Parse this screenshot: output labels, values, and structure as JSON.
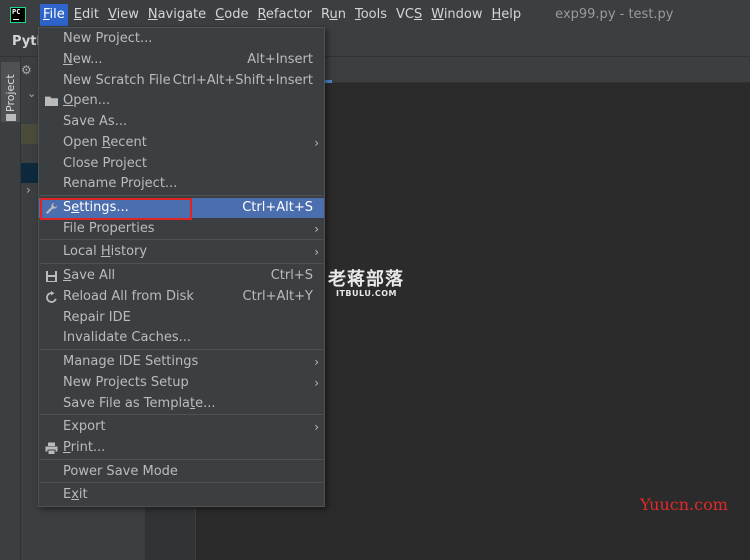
{
  "menubar": {
    "app_icon_text": "PC",
    "items": [
      {
        "pre": "",
        "mn": "F",
        "post": "ile",
        "active": true
      },
      {
        "pre": "",
        "mn": "E",
        "post": "dit"
      },
      {
        "pre": "",
        "mn": "V",
        "post": "iew"
      },
      {
        "pre": "",
        "mn": "N",
        "post": "avigate"
      },
      {
        "pre": "",
        "mn": "C",
        "post": "ode"
      },
      {
        "pre": "",
        "mn": "R",
        "post": "efactor"
      },
      {
        "pre": "R",
        "mn": "u",
        "post": "n"
      },
      {
        "pre": "",
        "mn": "T",
        "post": "ools"
      },
      {
        "pre": "VC",
        "mn": "S",
        "post": ""
      },
      {
        "pre": "",
        "mn": "W",
        "post": "indow"
      },
      {
        "pre": "",
        "mn": "H",
        "post": "elp"
      }
    ],
    "window_title": "exp99.py - test.py"
  },
  "header": {
    "breadcrumb": "Pyth"
  },
  "toolstrip": {
    "project_label": "Project"
  },
  "file_menu": {
    "items": [
      {
        "label": "New Project...",
        "shortcut": ""
      },
      {
        "label": "New...",
        "shortcut": "Alt+Insert"
      },
      {
        "label": "New Scratch File",
        "shortcut": "Ctrl+Alt+Shift+Insert"
      },
      {
        "label": "Open...",
        "shortcut": "",
        "icon": "folder-icon"
      },
      {
        "label": "Save As...",
        "shortcut": ""
      },
      {
        "label": "Open Recent",
        "shortcut": "",
        "submenu": true
      },
      {
        "label": "Close Project",
        "shortcut": ""
      },
      {
        "label": "Rename Project...",
        "shortcut": ""
      },
      {
        "label": "Settings...",
        "shortcut": "Ctrl+Alt+S",
        "icon": "wrench-icon",
        "selected": true
      },
      {
        "label": "File Properties",
        "shortcut": "",
        "submenu": true
      },
      {
        "label": "Local History",
        "shortcut": "",
        "submenu": true
      },
      {
        "label": "Save All",
        "shortcut": "Ctrl+S",
        "icon": "save-icon"
      },
      {
        "label": "Reload All from Disk",
        "shortcut": "Ctrl+Alt+Y",
        "icon": "reload-icon"
      },
      {
        "label": "Repair IDE",
        "shortcut": ""
      },
      {
        "label": "Invalidate Caches...",
        "shortcut": ""
      },
      {
        "label": "Manage IDE Settings",
        "shortcut": "",
        "submenu": true
      },
      {
        "label": "New Projects Setup",
        "shortcut": "",
        "submenu": true
      },
      {
        "label": "Save File as Template...",
        "shortcut": ""
      },
      {
        "label": "Export",
        "shortcut": "",
        "submenu": true
      },
      {
        "label": "Print...",
        "shortcut": "",
        "icon": "print-icon"
      },
      {
        "label": "Power Save Mode",
        "shortcut": ""
      },
      {
        "label": "Exit",
        "shortcut": ""
      }
    ],
    "submenu_arrow": "›"
  },
  "watermarks": {
    "main": "老蒋部落",
    "sub": "ITBULU.COM",
    "corner": "Yuucn.com"
  },
  "colors": {
    "selection": "#4b6eaf",
    "menu_active": "#2f65ca",
    "highlight_box": "#e02424"
  }
}
